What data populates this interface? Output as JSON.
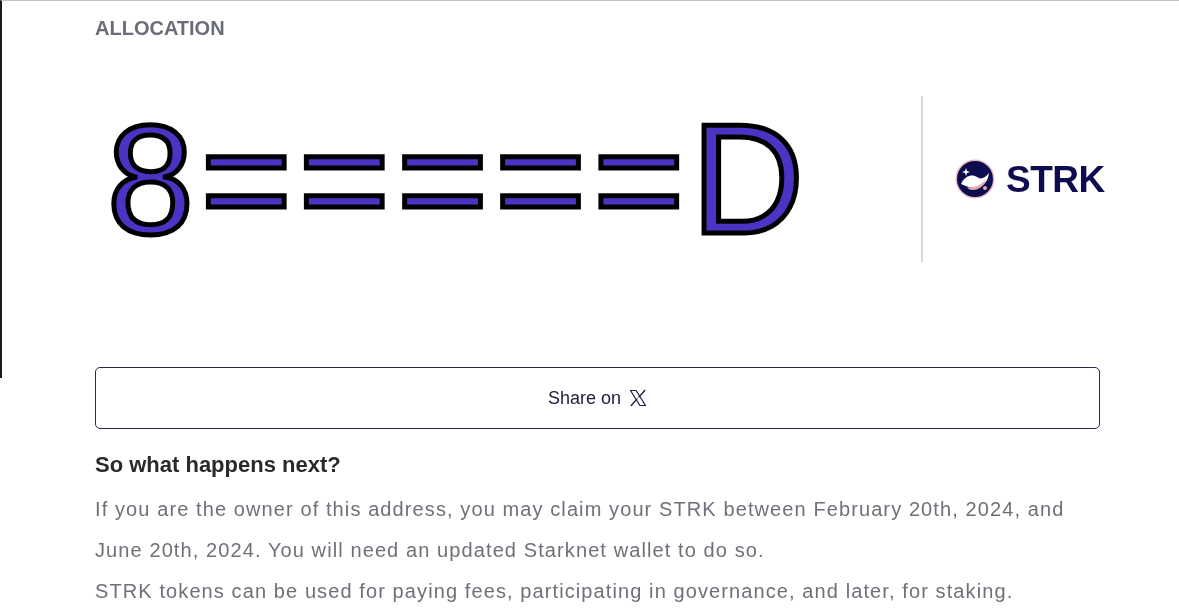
{
  "allocation": {
    "label": "ALLOCATION",
    "amount": "8=====D",
    "token": "STRK"
  },
  "share_button": {
    "label": "Share on"
  },
  "next_steps": {
    "heading": "So what happens next?",
    "paragraphs": [
      "If you are the owner of this address, you may claim your STRK between February 20th, 2024, and June 20th, 2024. You will need an updated Starknet wallet to do so.",
      "STRK tokens can be used for paying fees, participating in governance, and later, for staking."
    ]
  }
}
